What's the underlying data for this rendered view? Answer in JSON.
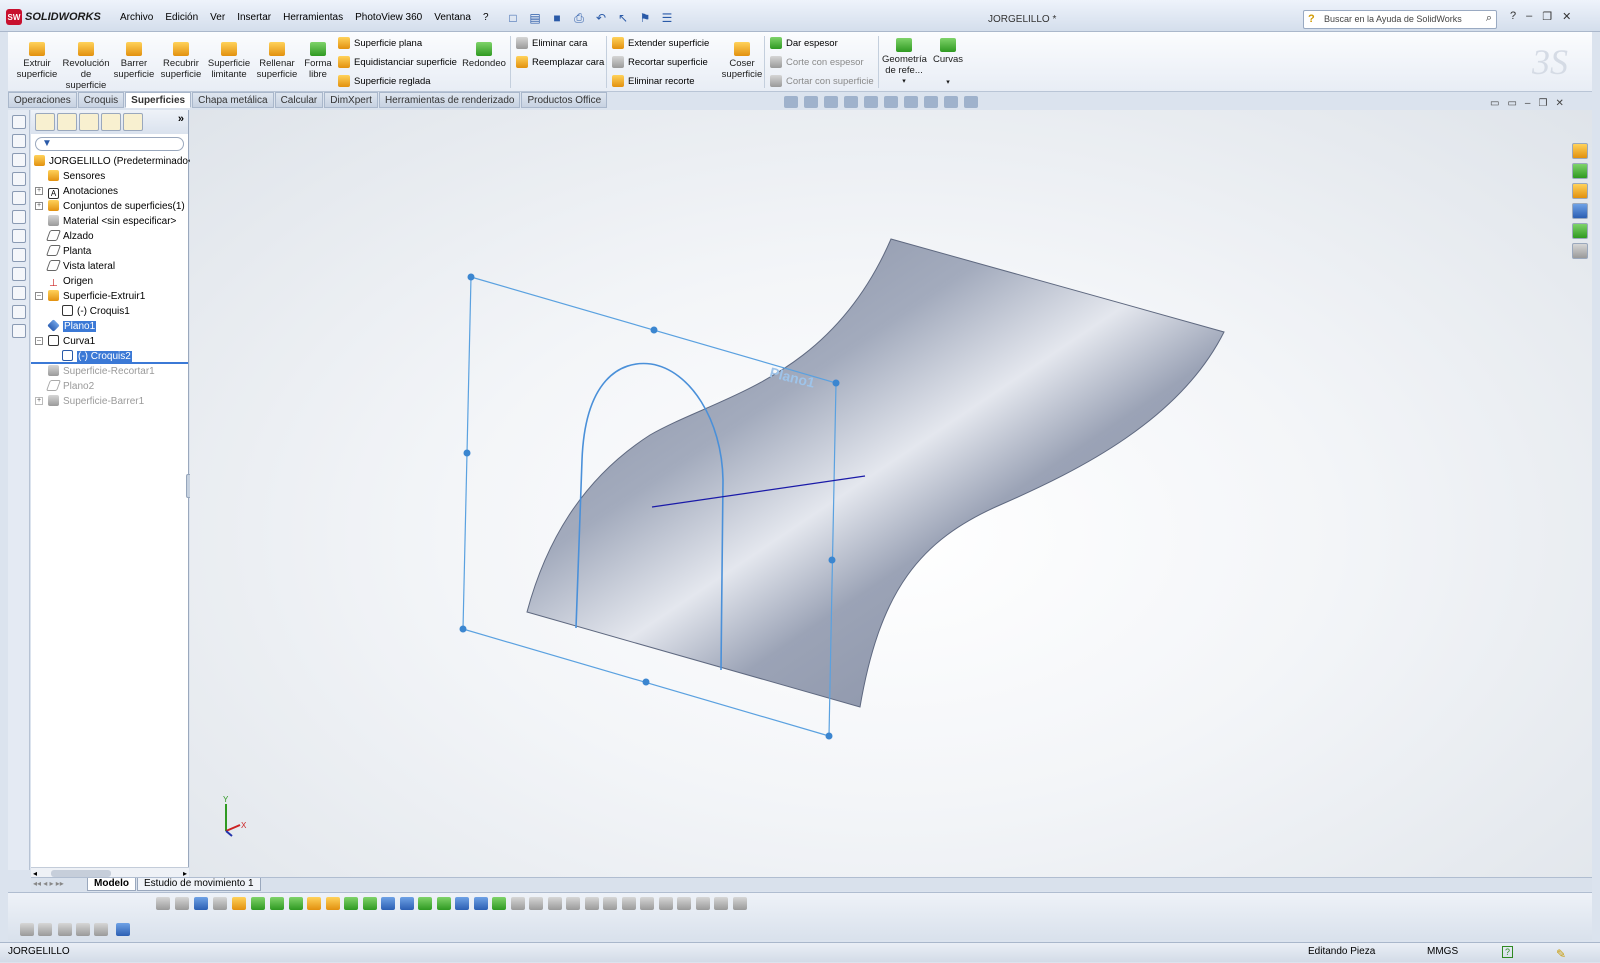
{
  "app": {
    "logo": "SOLIDWORKS",
    "window_title": "JORGELILLO *"
  },
  "menu": [
    "Archivo",
    "Edición",
    "Ver",
    "Insertar",
    "Herramientas",
    "PhotoView 360",
    "Ventana",
    "?"
  ],
  "search": {
    "placeholder": "Buscar en la Ayuda de SolidWorks"
  },
  "ribbon": {
    "big_buttons": [
      {
        "label": "Extruir superficie",
        "icon": "extrude-surface-icon"
      },
      {
        "label": "Revolución de superficie",
        "icon": "revolve-surface-icon"
      },
      {
        "label": "Barrer superficie",
        "icon": "sweep-surface-icon"
      },
      {
        "label": "Recubrir superficie",
        "icon": "loft-surface-icon"
      },
      {
        "label": "Superficie limitante",
        "icon": "boundary-surface-icon"
      },
      {
        "label": "Rellenar superficie",
        "icon": "fill-surface-icon"
      },
      {
        "label": "Forma libre",
        "icon": "freeform-icon"
      }
    ],
    "col1": [
      "Superficie plana",
      "Equidistanciar superficie",
      "Superficie reglada"
    ],
    "redondeo": "Redondeo",
    "col2": [
      "Eliminar cara",
      "Reemplazar cara"
    ],
    "col3": [
      "Extender superficie",
      "Recortar superficie",
      "Eliminar recorte"
    ],
    "coser": "Coser superficie",
    "col4": [
      "Dar espesor",
      "Corte con espesor",
      "Cortar con superficie"
    ],
    "geometria": "Geometría de refe...",
    "curvas": "Curvas"
  },
  "tabs": [
    "Operaciones",
    "Croquis",
    "Superficies",
    "Chapa metálica",
    "Calcular",
    "DimXpert",
    "Herramientas de renderizado",
    "Productos Office"
  ],
  "active_tab": "Superficies",
  "tree": {
    "root": "JORGELILLO  (Predeterminado<",
    "items": [
      {
        "label": "Sensores",
        "state": "normal"
      },
      {
        "label": "Anotaciones",
        "state": "normal"
      },
      {
        "label": "Conjuntos de superficies(1)",
        "state": "normal"
      },
      {
        "label": "Material <sin especificar>",
        "state": "normal"
      },
      {
        "label": "Alzado",
        "state": "normal"
      },
      {
        "label": "Planta",
        "state": "normal"
      },
      {
        "label": "Vista lateral",
        "state": "normal"
      },
      {
        "label": "Origen",
        "state": "normal"
      },
      {
        "label": "Superficie-Extruir1",
        "state": "normal"
      },
      {
        "label": "(-) Croquis1",
        "state": "normal"
      },
      {
        "label": "Plano1",
        "state": "selected"
      },
      {
        "label": "Curva1",
        "state": "normal"
      },
      {
        "label": "(-) Croquis2",
        "state": "selected"
      },
      {
        "label": "Superficie-Recortar1",
        "state": "suppressed"
      },
      {
        "label": "Plano2",
        "state": "suppressed"
      },
      {
        "label": "Superficie-Barrer1",
        "state": "suppressed"
      }
    ]
  },
  "viewport": {
    "plane_label": "Plano1",
    "triad": {
      "x": "X",
      "y": "Y"
    }
  },
  "bottom_tabs": [
    "Modelo",
    "Estudio de movimiento 1"
  ],
  "status": {
    "left": "JORGELILLO",
    "editing": "Editando Pieza",
    "units": "MMGS"
  },
  "colors": {
    "surface": "#8d96ad",
    "sketch": "#4a90d9",
    "curve": "#1a1aa8"
  }
}
